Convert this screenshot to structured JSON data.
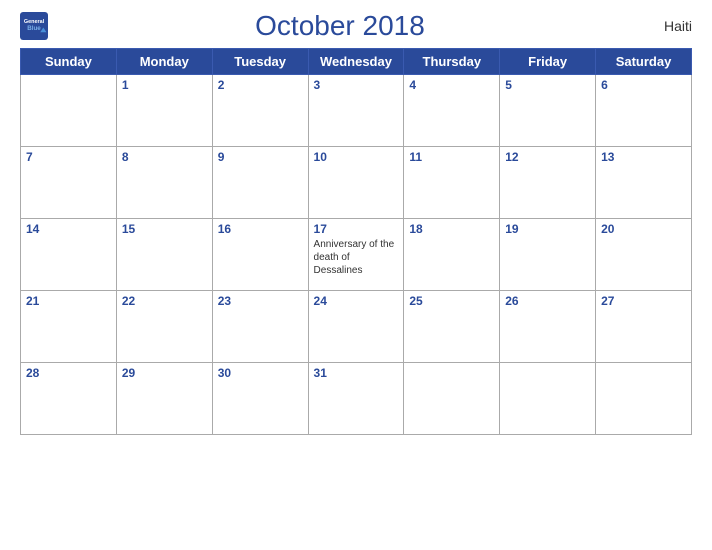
{
  "header": {
    "logo_line1": "General",
    "logo_line2": "Blue",
    "title": "October 2018",
    "country": "Haiti"
  },
  "weekdays": [
    "Sunday",
    "Monday",
    "Tuesday",
    "Wednesday",
    "Thursday",
    "Friday",
    "Saturday"
  ],
  "weeks": [
    [
      {
        "day": "",
        "events": []
      },
      {
        "day": "1",
        "events": []
      },
      {
        "day": "2",
        "events": []
      },
      {
        "day": "3",
        "events": []
      },
      {
        "day": "4",
        "events": []
      },
      {
        "day": "5",
        "events": []
      },
      {
        "day": "6",
        "events": []
      }
    ],
    [
      {
        "day": "7",
        "events": []
      },
      {
        "day": "8",
        "events": []
      },
      {
        "day": "9",
        "events": []
      },
      {
        "day": "10",
        "events": []
      },
      {
        "day": "11",
        "events": []
      },
      {
        "day": "12",
        "events": []
      },
      {
        "day": "13",
        "events": []
      }
    ],
    [
      {
        "day": "14",
        "events": []
      },
      {
        "day": "15",
        "events": []
      },
      {
        "day": "16",
        "events": []
      },
      {
        "day": "17",
        "events": [
          "Anniversary of the death of Dessalines"
        ]
      },
      {
        "day": "18",
        "events": []
      },
      {
        "day": "19",
        "events": []
      },
      {
        "day": "20",
        "events": []
      }
    ],
    [
      {
        "day": "21",
        "events": []
      },
      {
        "day": "22",
        "events": []
      },
      {
        "day": "23",
        "events": []
      },
      {
        "day": "24",
        "events": []
      },
      {
        "day": "25",
        "events": []
      },
      {
        "day": "26",
        "events": []
      },
      {
        "day": "27",
        "events": []
      }
    ],
    [
      {
        "day": "28",
        "events": []
      },
      {
        "day": "29",
        "events": []
      },
      {
        "day": "30",
        "events": []
      },
      {
        "day": "31",
        "events": []
      },
      {
        "day": "",
        "events": []
      },
      {
        "day": "",
        "events": []
      },
      {
        "day": "",
        "events": []
      }
    ]
  ]
}
